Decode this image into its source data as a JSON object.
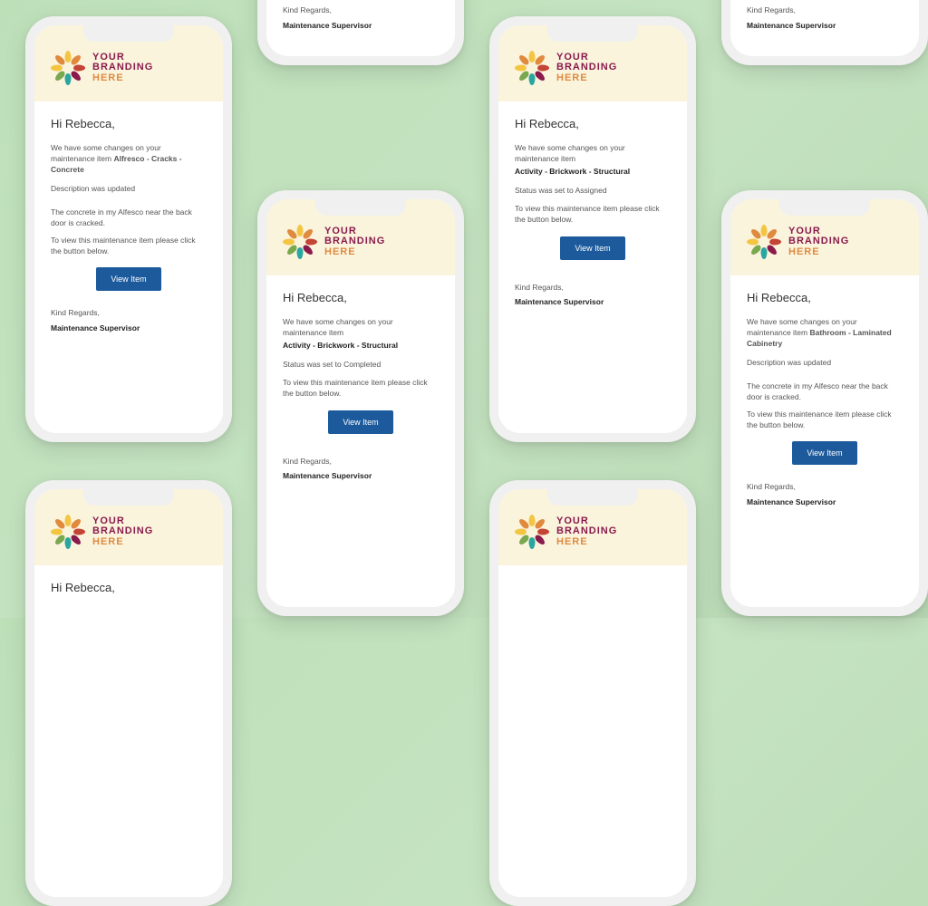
{
  "branding": {
    "line1": "YOUR",
    "line2": "BRANDING",
    "line3": "HERE"
  },
  "button_label": "View Item",
  "regards": "Kind Regards,",
  "signoff": "Maintenance Supervisor",
  "greeting": "Hi Rebecca,",
  "intro_full": "We have some changes on your maintenance item",
  "instruction": "To view this maintenance item please click the button below.",
  "emails": {
    "alfresco": {
      "intro": "We have some changes on your maintenance item Alfresco - Cracks - Concrete",
      "item": "Alfresco - Cracks - Concrete",
      "status": "Description was updated",
      "desc": "The concrete in my Alfesco near the back door is cracked."
    },
    "activity_completed": {
      "item": "Activity - Brickwork - Structural",
      "status": "Status was set to Completed"
    },
    "activity_assigned": {
      "item": "Activity - Brickwork - Structural",
      "status": "Status was set to Assigned"
    },
    "bathroom": {
      "item": "Bathroom - Laminated Cabinetry",
      "status": "Description was updated",
      "desc": "The concrete in my Alfesco near the back door is cracked."
    }
  },
  "logo_colors": {
    "yellow": "#f4c542",
    "orange": "#e08a3e",
    "teal": "#2aa6a0",
    "magenta": "#8a1a4c",
    "green": "#7aa84f",
    "red": "#c44536"
  }
}
